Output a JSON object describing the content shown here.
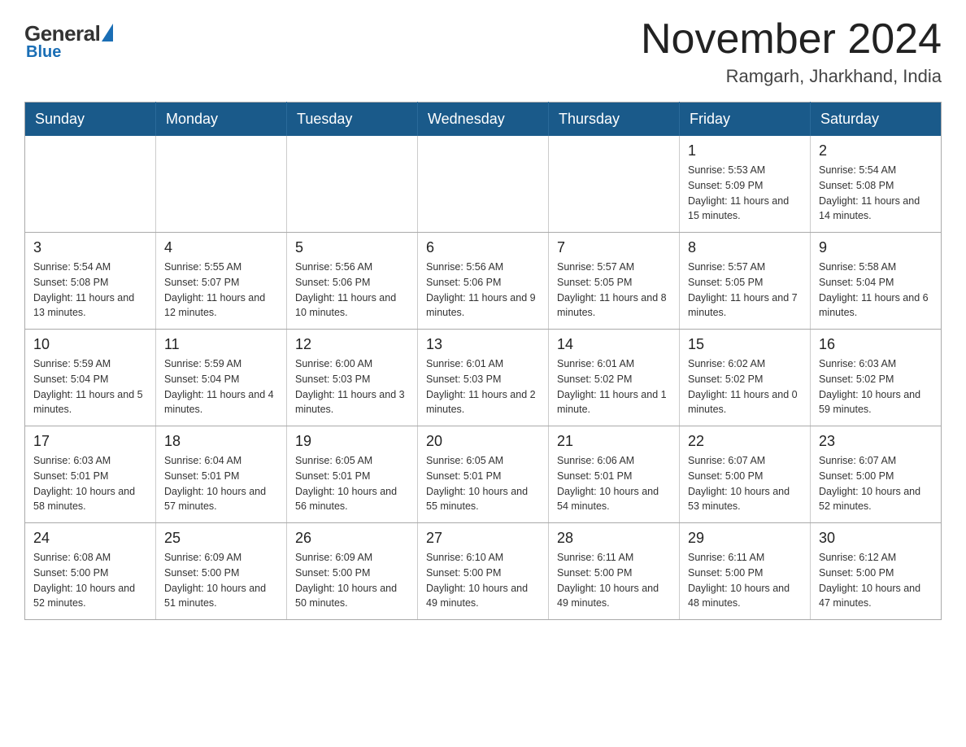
{
  "header": {
    "logo_general": "General",
    "logo_blue": "Blue",
    "main_title": "November 2024",
    "subtitle": "Ramgarh, Jharkhand, India"
  },
  "weekdays": [
    "Sunday",
    "Monday",
    "Tuesday",
    "Wednesday",
    "Thursday",
    "Friday",
    "Saturday"
  ],
  "rows": [
    [
      {
        "day": "",
        "sunrise": "",
        "sunset": "",
        "daylight": ""
      },
      {
        "day": "",
        "sunrise": "",
        "sunset": "",
        "daylight": ""
      },
      {
        "day": "",
        "sunrise": "",
        "sunset": "",
        "daylight": ""
      },
      {
        "day": "",
        "sunrise": "",
        "sunset": "",
        "daylight": ""
      },
      {
        "day": "",
        "sunrise": "",
        "sunset": "",
        "daylight": ""
      },
      {
        "day": "1",
        "sunrise": "Sunrise: 5:53 AM",
        "sunset": "Sunset: 5:09 PM",
        "daylight": "Daylight: 11 hours and 15 minutes."
      },
      {
        "day": "2",
        "sunrise": "Sunrise: 5:54 AM",
        "sunset": "Sunset: 5:08 PM",
        "daylight": "Daylight: 11 hours and 14 minutes."
      }
    ],
    [
      {
        "day": "3",
        "sunrise": "Sunrise: 5:54 AM",
        "sunset": "Sunset: 5:08 PM",
        "daylight": "Daylight: 11 hours and 13 minutes."
      },
      {
        "day": "4",
        "sunrise": "Sunrise: 5:55 AM",
        "sunset": "Sunset: 5:07 PM",
        "daylight": "Daylight: 11 hours and 12 minutes."
      },
      {
        "day": "5",
        "sunrise": "Sunrise: 5:56 AM",
        "sunset": "Sunset: 5:06 PM",
        "daylight": "Daylight: 11 hours and 10 minutes."
      },
      {
        "day": "6",
        "sunrise": "Sunrise: 5:56 AM",
        "sunset": "Sunset: 5:06 PM",
        "daylight": "Daylight: 11 hours and 9 minutes."
      },
      {
        "day": "7",
        "sunrise": "Sunrise: 5:57 AM",
        "sunset": "Sunset: 5:05 PM",
        "daylight": "Daylight: 11 hours and 8 minutes."
      },
      {
        "day": "8",
        "sunrise": "Sunrise: 5:57 AM",
        "sunset": "Sunset: 5:05 PM",
        "daylight": "Daylight: 11 hours and 7 minutes."
      },
      {
        "day": "9",
        "sunrise": "Sunrise: 5:58 AM",
        "sunset": "Sunset: 5:04 PM",
        "daylight": "Daylight: 11 hours and 6 minutes."
      }
    ],
    [
      {
        "day": "10",
        "sunrise": "Sunrise: 5:59 AM",
        "sunset": "Sunset: 5:04 PM",
        "daylight": "Daylight: 11 hours and 5 minutes."
      },
      {
        "day": "11",
        "sunrise": "Sunrise: 5:59 AM",
        "sunset": "Sunset: 5:04 PM",
        "daylight": "Daylight: 11 hours and 4 minutes."
      },
      {
        "day": "12",
        "sunrise": "Sunrise: 6:00 AM",
        "sunset": "Sunset: 5:03 PM",
        "daylight": "Daylight: 11 hours and 3 minutes."
      },
      {
        "day": "13",
        "sunrise": "Sunrise: 6:01 AM",
        "sunset": "Sunset: 5:03 PM",
        "daylight": "Daylight: 11 hours and 2 minutes."
      },
      {
        "day": "14",
        "sunrise": "Sunrise: 6:01 AM",
        "sunset": "Sunset: 5:02 PM",
        "daylight": "Daylight: 11 hours and 1 minute."
      },
      {
        "day": "15",
        "sunrise": "Sunrise: 6:02 AM",
        "sunset": "Sunset: 5:02 PM",
        "daylight": "Daylight: 11 hours and 0 minutes."
      },
      {
        "day": "16",
        "sunrise": "Sunrise: 6:03 AM",
        "sunset": "Sunset: 5:02 PM",
        "daylight": "Daylight: 10 hours and 59 minutes."
      }
    ],
    [
      {
        "day": "17",
        "sunrise": "Sunrise: 6:03 AM",
        "sunset": "Sunset: 5:01 PM",
        "daylight": "Daylight: 10 hours and 58 minutes."
      },
      {
        "day": "18",
        "sunrise": "Sunrise: 6:04 AM",
        "sunset": "Sunset: 5:01 PM",
        "daylight": "Daylight: 10 hours and 57 minutes."
      },
      {
        "day": "19",
        "sunrise": "Sunrise: 6:05 AM",
        "sunset": "Sunset: 5:01 PM",
        "daylight": "Daylight: 10 hours and 56 minutes."
      },
      {
        "day": "20",
        "sunrise": "Sunrise: 6:05 AM",
        "sunset": "Sunset: 5:01 PM",
        "daylight": "Daylight: 10 hours and 55 minutes."
      },
      {
        "day": "21",
        "sunrise": "Sunrise: 6:06 AM",
        "sunset": "Sunset: 5:01 PM",
        "daylight": "Daylight: 10 hours and 54 minutes."
      },
      {
        "day": "22",
        "sunrise": "Sunrise: 6:07 AM",
        "sunset": "Sunset: 5:00 PM",
        "daylight": "Daylight: 10 hours and 53 minutes."
      },
      {
        "day": "23",
        "sunrise": "Sunrise: 6:07 AM",
        "sunset": "Sunset: 5:00 PM",
        "daylight": "Daylight: 10 hours and 52 minutes."
      }
    ],
    [
      {
        "day": "24",
        "sunrise": "Sunrise: 6:08 AM",
        "sunset": "Sunset: 5:00 PM",
        "daylight": "Daylight: 10 hours and 52 minutes."
      },
      {
        "day": "25",
        "sunrise": "Sunrise: 6:09 AM",
        "sunset": "Sunset: 5:00 PM",
        "daylight": "Daylight: 10 hours and 51 minutes."
      },
      {
        "day": "26",
        "sunrise": "Sunrise: 6:09 AM",
        "sunset": "Sunset: 5:00 PM",
        "daylight": "Daylight: 10 hours and 50 minutes."
      },
      {
        "day": "27",
        "sunrise": "Sunrise: 6:10 AM",
        "sunset": "Sunset: 5:00 PM",
        "daylight": "Daylight: 10 hours and 49 minutes."
      },
      {
        "day": "28",
        "sunrise": "Sunrise: 6:11 AM",
        "sunset": "Sunset: 5:00 PM",
        "daylight": "Daylight: 10 hours and 49 minutes."
      },
      {
        "day": "29",
        "sunrise": "Sunrise: 6:11 AM",
        "sunset": "Sunset: 5:00 PM",
        "daylight": "Daylight: 10 hours and 48 minutes."
      },
      {
        "day": "30",
        "sunrise": "Sunrise: 6:12 AM",
        "sunset": "Sunset: 5:00 PM",
        "daylight": "Daylight: 10 hours and 47 minutes."
      }
    ]
  ]
}
